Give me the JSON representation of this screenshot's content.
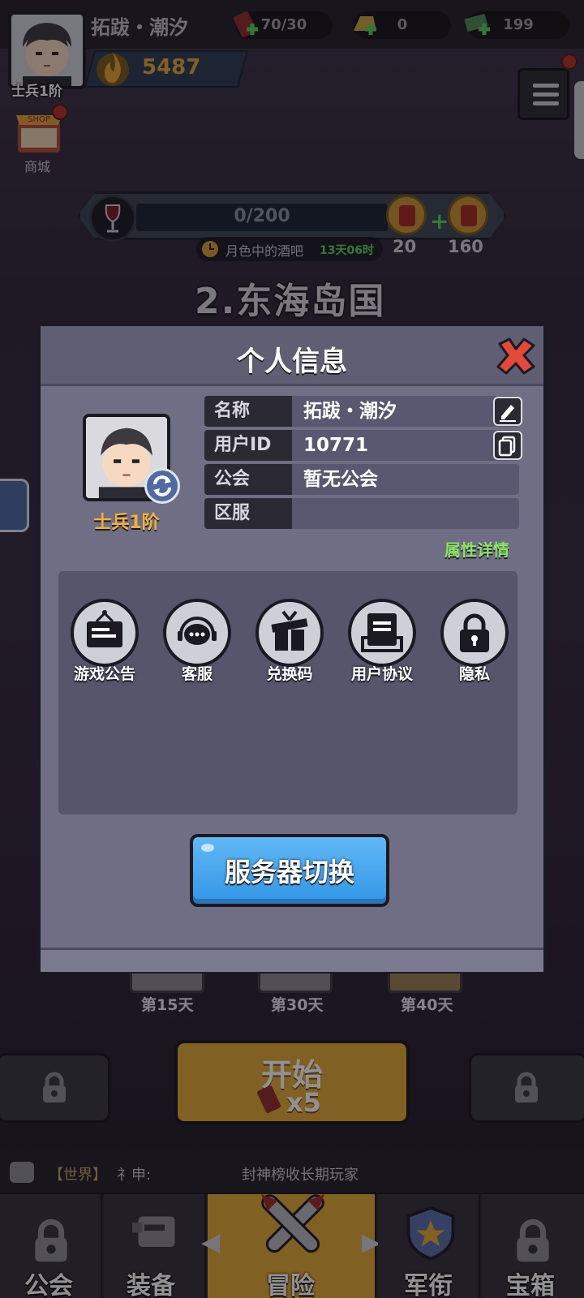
{
  "header": {
    "player_name": "拓跋・潮汐",
    "rank": "士兵1阶",
    "power": "5487",
    "resources": [
      {
        "icon": "stamina-icon",
        "value": "70/30"
      },
      {
        "icon": "gold-bar-icon",
        "value": "0"
      },
      {
        "icon": "cash-icon",
        "value": "199"
      }
    ],
    "shop_label": "商城"
  },
  "event": {
    "progress_text": "0/200",
    "progress_fraction": 0,
    "name": "月色中的酒吧",
    "time_left": "13天06时",
    "rewards": [
      "20",
      "160"
    ]
  },
  "stage": {
    "title": "2.东海岛国",
    "day_rewards": [
      "第15天",
      "第30天",
      "第40天"
    ],
    "start_label": "开始",
    "start_cost": "x5"
  },
  "chat": {
    "channel": "【世界】",
    "sender": "礻申:",
    "message": "封神榜收长期玩家"
  },
  "nav": {
    "items": [
      {
        "label": "公会",
        "icon": "lock-icon"
      },
      {
        "label": "装备",
        "icon": "turret-icon"
      },
      {
        "label": "冒险",
        "icon": "crossed-missiles-icon"
      },
      {
        "label": "军衔",
        "icon": "rank-shield-icon"
      },
      {
        "label": "宝箱",
        "icon": "lock-icon"
      }
    ],
    "active": "冒险"
  },
  "modal": {
    "title": "个人信息",
    "rank": "士兵1阶",
    "rows": [
      {
        "key": "名称",
        "value": "拓跋・潮汐"
      },
      {
        "key": "用户ID",
        "value": "10771"
      },
      {
        "key": "公会",
        "value": "暂无公会"
      },
      {
        "key": "区服",
        "value": ""
      }
    ],
    "attr_link": "属性详情",
    "functions": [
      {
        "label": "游戏公告",
        "icon": "notice-board-icon"
      },
      {
        "label": "客服",
        "icon": "headset-icon"
      },
      {
        "label": "兑换码",
        "icon": "gift-icon"
      },
      {
        "label": "用户协议",
        "icon": "document-icon"
      },
      {
        "label": "隐私",
        "icon": "padlock-icon"
      }
    ],
    "server_button": "服务器切换"
  },
  "colors": {
    "accent_yellow": "#e2a837",
    "button_blue": "#3396e6",
    "link_green": "#8ee26a",
    "rank_orange": "#f2b03d",
    "modal_bg": "#6f6e84"
  }
}
